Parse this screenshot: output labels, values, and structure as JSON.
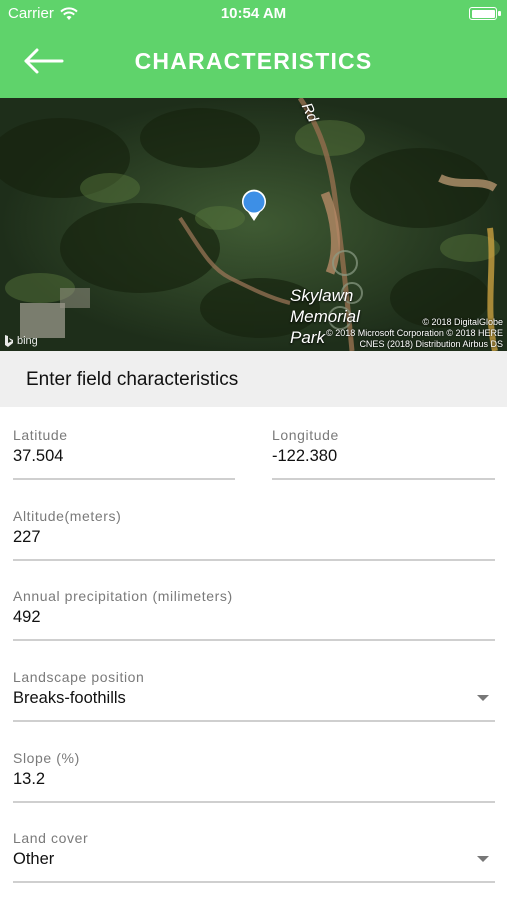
{
  "status_bar": {
    "carrier": "Carrier",
    "time": "10:54 AM",
    "battery_level": 1.0
  },
  "nav": {
    "title": "CHARACTERISTICS",
    "back_icon": "arrow-left-icon"
  },
  "map": {
    "road_label": "Rd",
    "place_label_line1": "Skylawn",
    "place_label_line2": "Memorial",
    "place_label_line3": "Park",
    "copyright_line1": "© 2018 DigitalGlobe",
    "copyright_line2": "© 2018 Microsoft Corporation © 2018 HERE",
    "copyright_line3": "CNES (2018) Distribution Airbus DS",
    "bing_label": "bing"
  },
  "section": {
    "title": "Enter field characteristics"
  },
  "fields": {
    "latitude": {
      "label": "Latitude",
      "value": "37.504"
    },
    "longitude": {
      "label": "Longitude",
      "value": "-122.380"
    },
    "altitude": {
      "label": "Altitude(meters)",
      "value": "227"
    },
    "precipitation": {
      "label": "Annual precipitation (milimeters)",
      "value": "492"
    },
    "landscape": {
      "label": "Landscape position",
      "value": "Breaks-foothills"
    },
    "slope": {
      "label": "Slope (%)",
      "value": "13.2"
    },
    "land_cover": {
      "label": "Land cover",
      "value": "Other"
    }
  },
  "colors": {
    "accent": "#5fd36b",
    "pin": "#3d8fe6",
    "section_bg": "#efefef"
  }
}
